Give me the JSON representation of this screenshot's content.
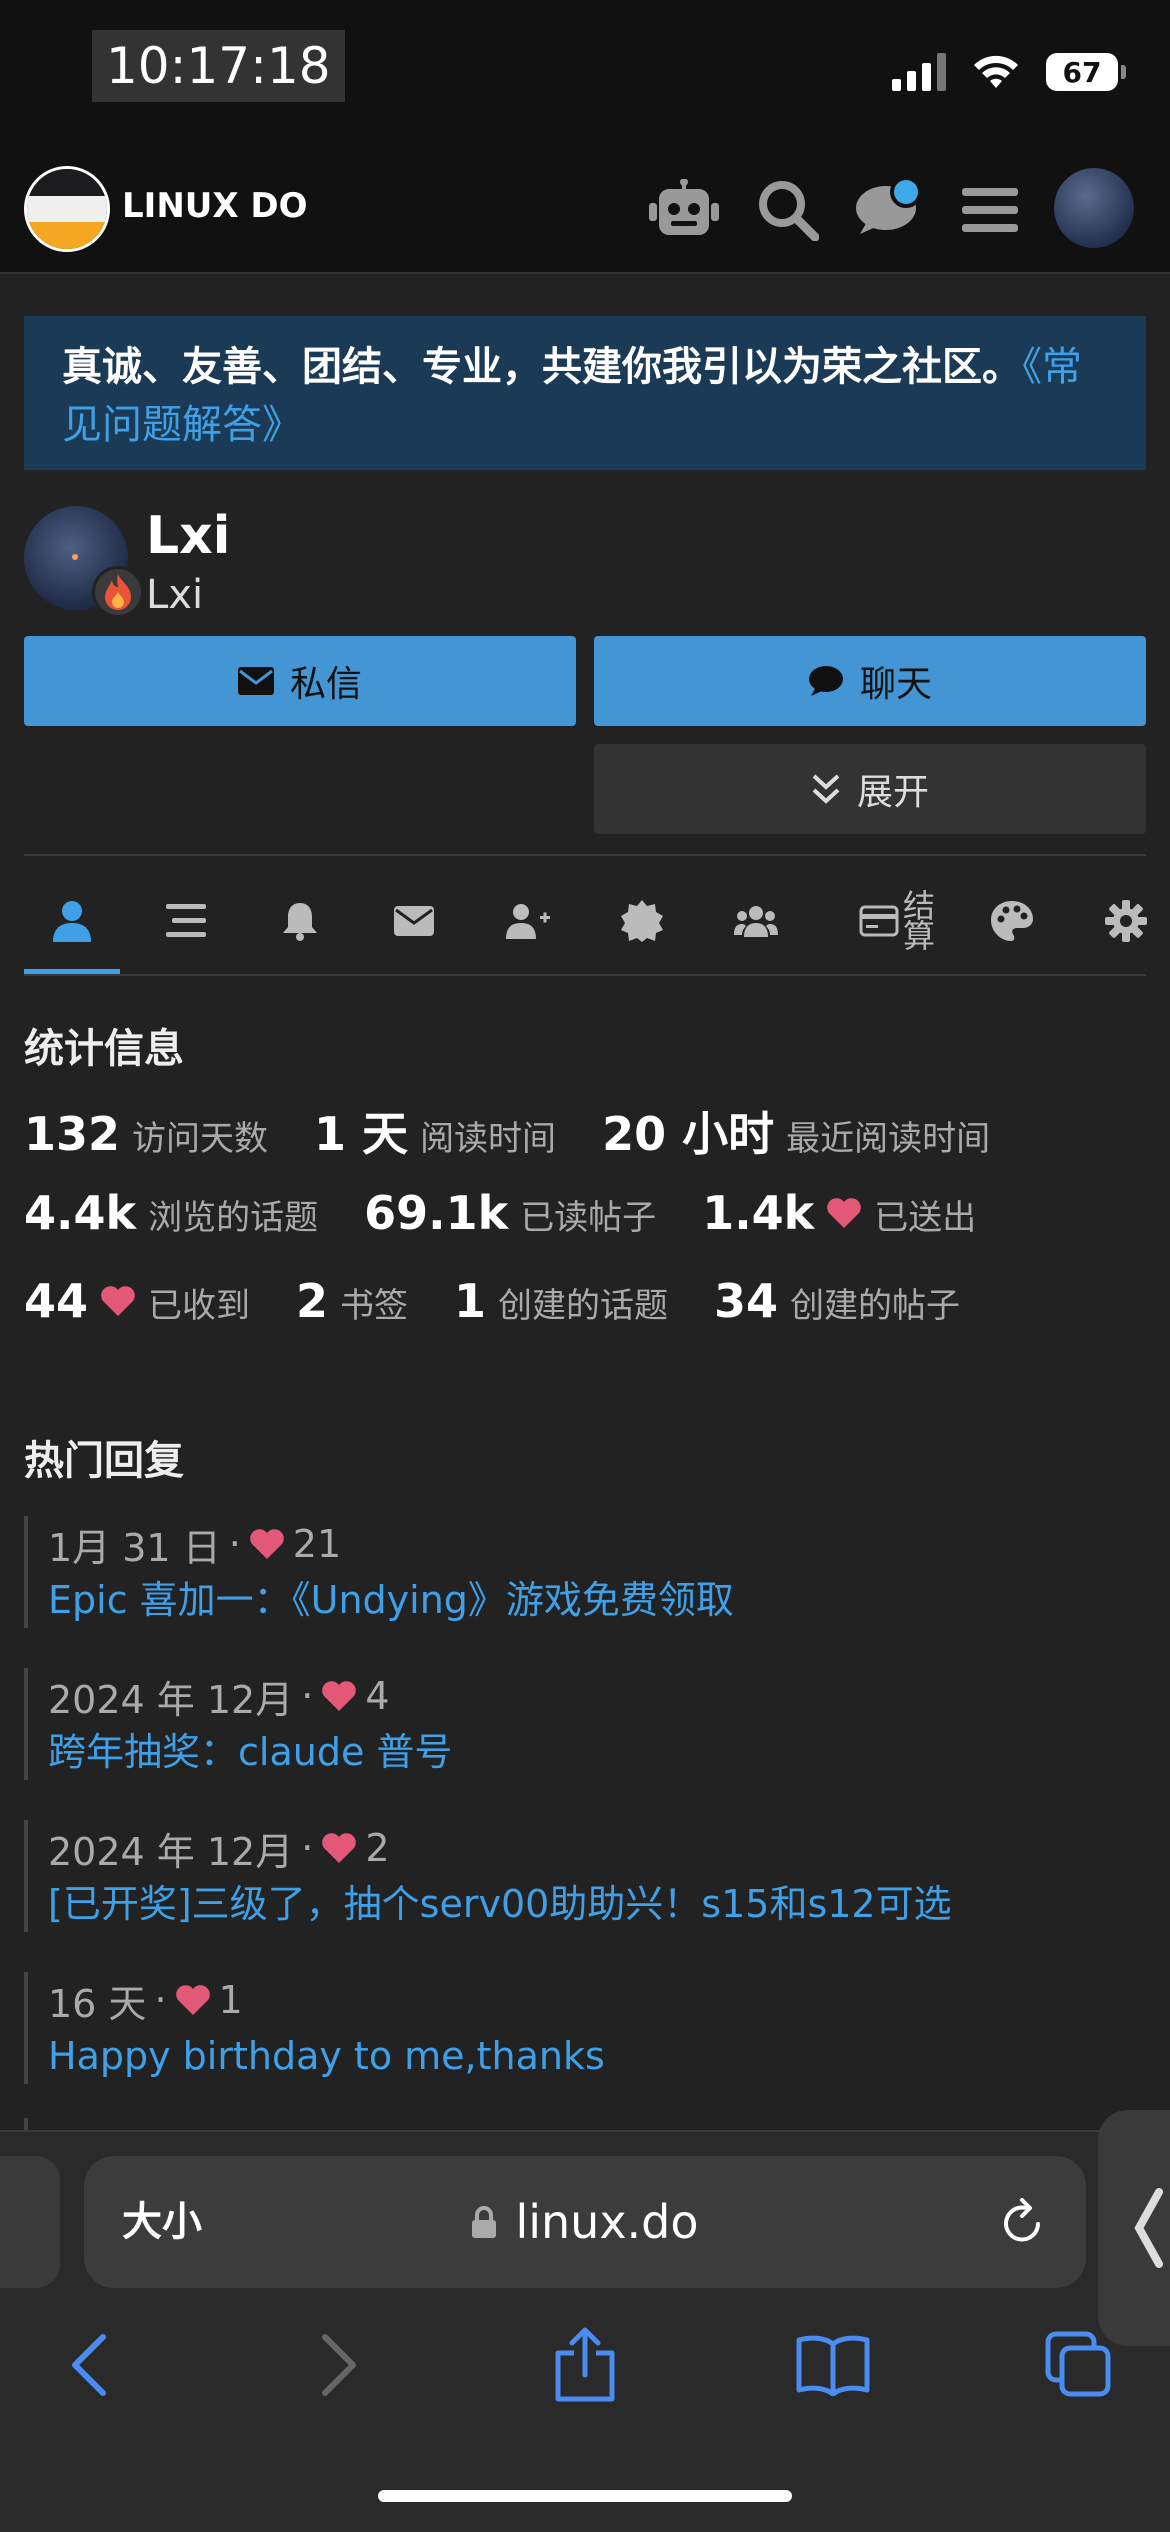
{
  "status_bar": {
    "time": "10:17:18",
    "battery": "67"
  },
  "header": {
    "site_title": "LINUX DO"
  },
  "banner": {
    "text": "真诚、友善、团结、专业，共建你我引以为荣之社区。",
    "link": "《常见问题解答》"
  },
  "profile": {
    "name": "Lxi",
    "username": "Lxi",
    "buttons": {
      "message": "私信",
      "chat": "聊天",
      "expand": "展开"
    }
  },
  "tabs": {
    "settle_label_line1": "结",
    "settle_label_line2": "算"
  },
  "stats": {
    "title": "统计信息",
    "items": [
      {
        "value": "132",
        "label": "访问天数"
      },
      {
        "value": "1 天",
        "label": "阅读时间"
      },
      {
        "value": "20 小时",
        "label": "最近阅读时间"
      },
      {
        "value": "4.4k",
        "label": "浏览的话题"
      },
      {
        "value": "69.1k",
        "label": "已读帖子"
      },
      {
        "value": "1.4k",
        "label": "已送出"
      },
      {
        "value": "44",
        "label": "已收到"
      },
      {
        "value": "2",
        "label": "书签"
      },
      {
        "value": "1",
        "label": "创建的话题"
      },
      {
        "value": "34",
        "label": "创建的帖子"
      }
    ]
  },
  "top_replies": {
    "title": "热门回复",
    "items": [
      {
        "date": "1月 31 日",
        "likes": "21",
        "title": "Epic 喜加一：《Undying》游戏免费领取"
      },
      {
        "date": "2024 年 12月",
        "likes": "4",
        "title": "跨年抽奖：claude 普号"
      },
      {
        "date": "2024 年 12月",
        "likes": "2",
        "title": "[已开奖]三级了，抽个serv00助助兴！s15和s12可选"
      },
      {
        "date": "16 天",
        "likes": "1",
        "title": "Happy birthday to me,thanks"
      }
    ]
  },
  "browser": {
    "aa_label": "大小",
    "url": "linux.do"
  },
  "colors": {
    "accent": "#3fa0e8",
    "button_blue": "#4396d3",
    "heart": "#e45978",
    "banner_bg": "#1b3a55"
  }
}
